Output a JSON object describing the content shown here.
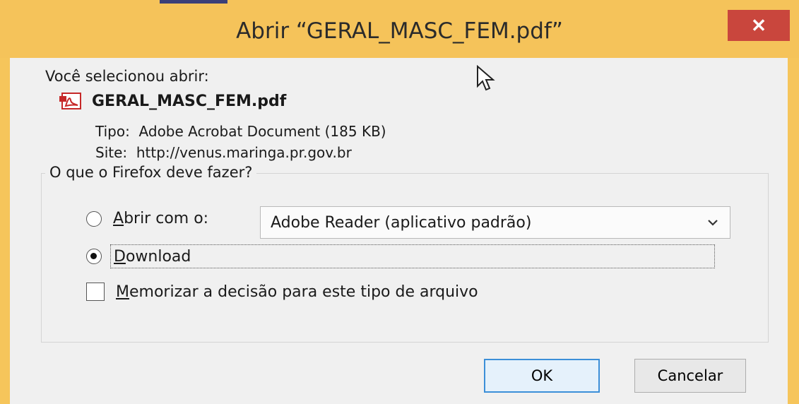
{
  "window": {
    "title": "Abrir “GERAL_MASC_FEM.pdf”",
    "close_glyph": "✕"
  },
  "file": {
    "intro": "Você selecionou abrir:",
    "name": "GERAL_MASC_FEM.pdf",
    "type_label": "Tipo:",
    "type_value": "Adobe Acrobat Document (185 KB)",
    "site_label": "Site:",
    "site_value": "http://venus.maringa.pr.gov.br",
    "icon": "pdf-icon"
  },
  "action": {
    "legend": "O que o Firefox deve fazer?",
    "open_with_prefix": "A",
    "open_with_rest": "brir com o:",
    "open_with_app": "Adobe Reader  (aplicativo padrão)",
    "download_prefix": "D",
    "download_rest": "ownload",
    "remember_prefix": "M",
    "remember_rest": "emorizar a decisão para este tipo de arquivo",
    "selected_option": "Download",
    "remember_checked": false
  },
  "buttons": {
    "ok": "OK",
    "cancel": "Cancelar"
  },
  "colors": {
    "titlebar": "#f5c35a",
    "close": "#c9463d",
    "ok_border": "#3c8fd8"
  }
}
